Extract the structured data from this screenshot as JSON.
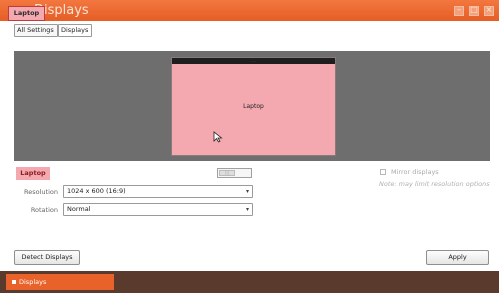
{
  "window": {
    "title": "Displays"
  },
  "tooltip": {
    "text": "Laptop"
  },
  "breadcrumb": {
    "all_settings": "All Settings",
    "current": "Displays"
  },
  "monitor": {
    "name": "Laptop"
  },
  "selected_display": {
    "name": "Laptop"
  },
  "mirror": {
    "label": "Mirror displays",
    "checked": false,
    "note": "Note: may limit resolution options"
  },
  "resolution": {
    "label": "Resolution",
    "value": "1024 x 600 (16:9)"
  },
  "rotation": {
    "label": "Rotation",
    "value": "Normal"
  },
  "buttons": {
    "detect": "Detect Displays",
    "apply": "Apply"
  },
  "taskbar": {
    "item": "Displays"
  },
  "colors": {
    "titlebar": "#e55e26",
    "highlight": "#f4a8b0",
    "arrange_bg": "#6e6e6e"
  }
}
